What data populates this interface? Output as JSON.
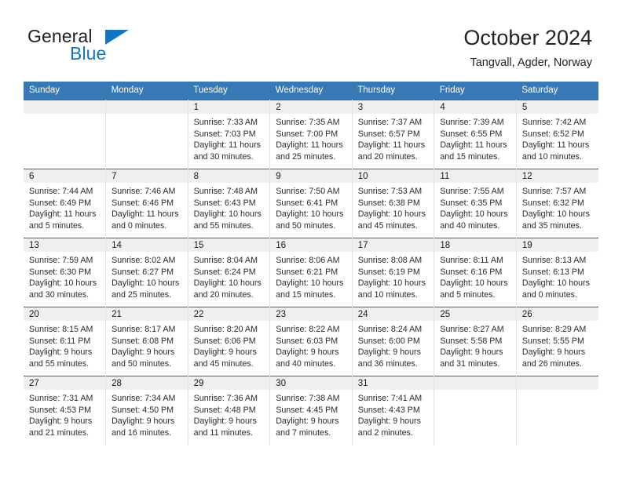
{
  "brand": {
    "name_part1": "General",
    "name_part2": "Blue",
    "accent_color": "#1574bb",
    "triangle_icon": "brand-triangle-icon"
  },
  "header": {
    "title": "October 2024",
    "subtitle": "Tangvall, Agder, Norway",
    "header_bg_color": "#3878b4",
    "row_divider_color": "#2d6ca8",
    "daynum_band_color": "#efefef"
  },
  "weekday_headers": [
    "Sunday",
    "Monday",
    "Tuesday",
    "Wednesday",
    "Thursday",
    "Friday",
    "Saturday"
  ],
  "weeks": [
    [
      {
        "day": "",
        "lines": []
      },
      {
        "day": "",
        "lines": []
      },
      {
        "day": "1",
        "lines": [
          "Sunrise: 7:33 AM",
          "Sunset: 7:03 PM",
          "Daylight: 11 hours",
          "and 30 minutes."
        ]
      },
      {
        "day": "2",
        "lines": [
          "Sunrise: 7:35 AM",
          "Sunset: 7:00 PM",
          "Daylight: 11 hours",
          "and 25 minutes."
        ]
      },
      {
        "day": "3",
        "lines": [
          "Sunrise: 7:37 AM",
          "Sunset: 6:57 PM",
          "Daylight: 11 hours",
          "and 20 minutes."
        ]
      },
      {
        "day": "4",
        "lines": [
          "Sunrise: 7:39 AM",
          "Sunset: 6:55 PM",
          "Daylight: 11 hours",
          "and 15 minutes."
        ]
      },
      {
        "day": "5",
        "lines": [
          "Sunrise: 7:42 AM",
          "Sunset: 6:52 PM",
          "Daylight: 11 hours",
          "and 10 minutes."
        ]
      }
    ],
    [
      {
        "day": "6",
        "lines": [
          "Sunrise: 7:44 AM",
          "Sunset: 6:49 PM",
          "Daylight: 11 hours",
          "and 5 minutes."
        ]
      },
      {
        "day": "7",
        "lines": [
          "Sunrise: 7:46 AM",
          "Sunset: 6:46 PM",
          "Daylight: 11 hours",
          "and 0 minutes."
        ]
      },
      {
        "day": "8",
        "lines": [
          "Sunrise: 7:48 AM",
          "Sunset: 6:43 PM",
          "Daylight: 10 hours",
          "and 55 minutes."
        ]
      },
      {
        "day": "9",
        "lines": [
          "Sunrise: 7:50 AM",
          "Sunset: 6:41 PM",
          "Daylight: 10 hours",
          "and 50 minutes."
        ]
      },
      {
        "day": "10",
        "lines": [
          "Sunrise: 7:53 AM",
          "Sunset: 6:38 PM",
          "Daylight: 10 hours",
          "and 45 minutes."
        ]
      },
      {
        "day": "11",
        "lines": [
          "Sunrise: 7:55 AM",
          "Sunset: 6:35 PM",
          "Daylight: 10 hours",
          "and 40 minutes."
        ]
      },
      {
        "day": "12",
        "lines": [
          "Sunrise: 7:57 AM",
          "Sunset: 6:32 PM",
          "Daylight: 10 hours",
          "and 35 minutes."
        ]
      }
    ],
    [
      {
        "day": "13",
        "lines": [
          "Sunrise: 7:59 AM",
          "Sunset: 6:30 PM",
          "Daylight: 10 hours",
          "and 30 minutes."
        ]
      },
      {
        "day": "14",
        "lines": [
          "Sunrise: 8:02 AM",
          "Sunset: 6:27 PM",
          "Daylight: 10 hours",
          "and 25 minutes."
        ]
      },
      {
        "day": "15",
        "lines": [
          "Sunrise: 8:04 AM",
          "Sunset: 6:24 PM",
          "Daylight: 10 hours",
          "and 20 minutes."
        ]
      },
      {
        "day": "16",
        "lines": [
          "Sunrise: 8:06 AM",
          "Sunset: 6:21 PM",
          "Daylight: 10 hours",
          "and 15 minutes."
        ]
      },
      {
        "day": "17",
        "lines": [
          "Sunrise: 8:08 AM",
          "Sunset: 6:19 PM",
          "Daylight: 10 hours",
          "and 10 minutes."
        ]
      },
      {
        "day": "18",
        "lines": [
          "Sunrise: 8:11 AM",
          "Sunset: 6:16 PM",
          "Daylight: 10 hours",
          "and 5 minutes."
        ]
      },
      {
        "day": "19",
        "lines": [
          "Sunrise: 8:13 AM",
          "Sunset: 6:13 PM",
          "Daylight: 10 hours",
          "and 0 minutes."
        ]
      }
    ],
    [
      {
        "day": "20",
        "lines": [
          "Sunrise: 8:15 AM",
          "Sunset: 6:11 PM",
          "Daylight: 9 hours",
          "and 55 minutes."
        ]
      },
      {
        "day": "21",
        "lines": [
          "Sunrise: 8:17 AM",
          "Sunset: 6:08 PM",
          "Daylight: 9 hours",
          "and 50 minutes."
        ]
      },
      {
        "day": "22",
        "lines": [
          "Sunrise: 8:20 AM",
          "Sunset: 6:06 PM",
          "Daylight: 9 hours",
          "and 45 minutes."
        ]
      },
      {
        "day": "23",
        "lines": [
          "Sunrise: 8:22 AM",
          "Sunset: 6:03 PM",
          "Daylight: 9 hours",
          "and 40 minutes."
        ]
      },
      {
        "day": "24",
        "lines": [
          "Sunrise: 8:24 AM",
          "Sunset: 6:00 PM",
          "Daylight: 9 hours",
          "and 36 minutes."
        ]
      },
      {
        "day": "25",
        "lines": [
          "Sunrise: 8:27 AM",
          "Sunset: 5:58 PM",
          "Daylight: 9 hours",
          "and 31 minutes."
        ]
      },
      {
        "day": "26",
        "lines": [
          "Sunrise: 8:29 AM",
          "Sunset: 5:55 PM",
          "Daylight: 9 hours",
          "and 26 minutes."
        ]
      }
    ],
    [
      {
        "day": "27",
        "lines": [
          "Sunrise: 7:31 AM",
          "Sunset: 4:53 PM",
          "Daylight: 9 hours",
          "and 21 minutes."
        ]
      },
      {
        "day": "28",
        "lines": [
          "Sunrise: 7:34 AM",
          "Sunset: 4:50 PM",
          "Daylight: 9 hours",
          "and 16 minutes."
        ]
      },
      {
        "day": "29",
        "lines": [
          "Sunrise: 7:36 AM",
          "Sunset: 4:48 PM",
          "Daylight: 9 hours",
          "and 11 minutes."
        ]
      },
      {
        "day": "30",
        "lines": [
          "Sunrise: 7:38 AM",
          "Sunset: 4:45 PM",
          "Daylight: 9 hours",
          "and 7 minutes."
        ]
      },
      {
        "day": "31",
        "lines": [
          "Sunrise: 7:41 AM",
          "Sunset: 4:43 PM",
          "Daylight: 9 hours",
          "and 2 minutes."
        ]
      },
      {
        "day": "",
        "lines": []
      },
      {
        "day": "",
        "lines": []
      }
    ]
  ]
}
